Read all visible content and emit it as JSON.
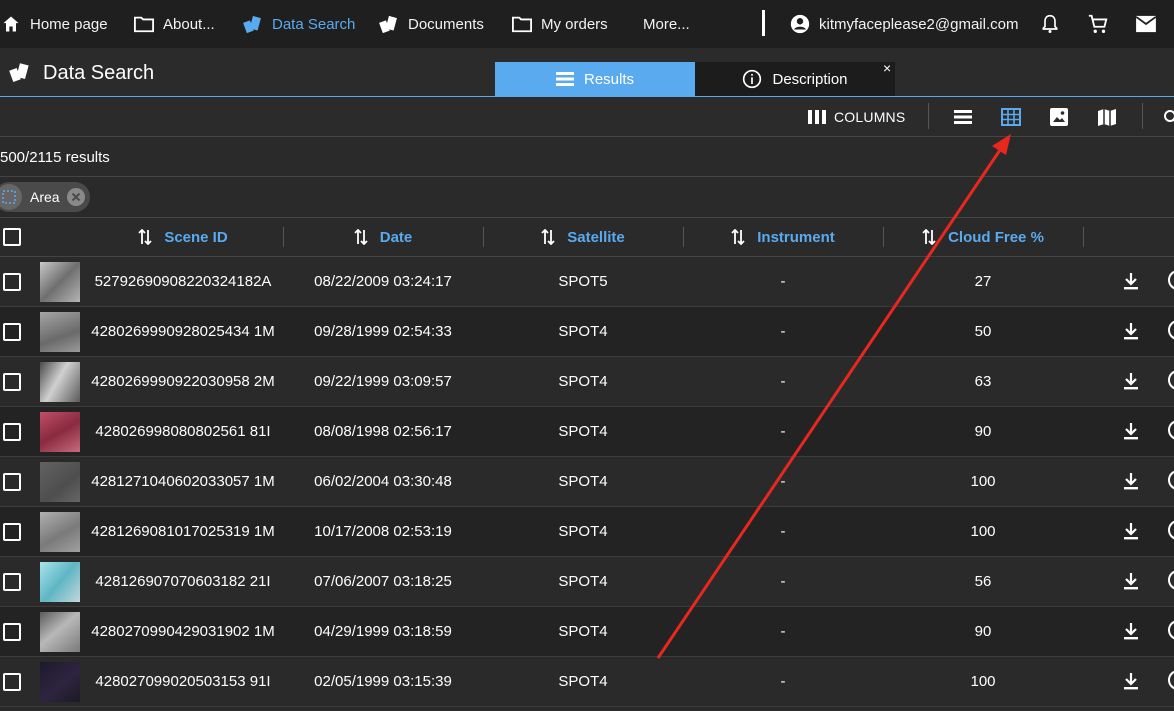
{
  "nav": {
    "home": "Home page",
    "about": "About...",
    "data_search": "Data Search",
    "documents": "Documents",
    "my_orders": "My orders",
    "more": "More...",
    "user_email": "kitmyfaceplease2@gmail.com"
  },
  "header": {
    "title": "Data Search",
    "tab_results": "Results",
    "tab_description": "Description",
    "tab_close": "×"
  },
  "toolbar": {
    "columns_label": "COLUMNS"
  },
  "results": {
    "count": "500/2115 results"
  },
  "filters": [
    {
      "label": "Area"
    }
  ],
  "table": {
    "columns": [
      "Scene ID",
      "Date",
      "Satellite",
      "Instrument",
      "Cloud Free %"
    ],
    "rows": [
      {
        "scene_id": "52792690908220324182A",
        "date": "08/22/2009 03:24:17",
        "satellite": "SPOT5",
        "instrument": "-",
        "cloud_free": "27",
        "thumb": "#9a9a9a"
      },
      {
        "scene_id": "4280269990928025434 1M",
        "date": "09/28/1999 02:54:33",
        "satellite": "SPOT4",
        "instrument": "-",
        "cloud_free": "50",
        "thumb": "#8c8c8c"
      },
      {
        "scene_id": "4280269990922030958 2M",
        "date": "09/22/1999 03:09:57",
        "satellite": "SPOT4",
        "instrument": "-",
        "cloud_free": "63",
        "thumb": "#7a7a7a"
      },
      {
        "scene_id": "428026998080802561 81I",
        "date": "08/08/1998 02:56:17",
        "satellite": "SPOT4",
        "instrument": "-",
        "cloud_free": "90",
        "thumb": "#b0405a"
      },
      {
        "scene_id": "4281271040602033057 1M",
        "date": "06/02/2004 03:30:48",
        "satellite": "SPOT4",
        "instrument": "-",
        "cloud_free": "100",
        "thumb": "#5e5e5e"
      },
      {
        "scene_id": "4281269081017025319 1M",
        "date": "10/17/2008 02:53:19",
        "satellite": "SPOT4",
        "instrument": "-",
        "cloud_free": "100",
        "thumb": "#8e8e8e"
      },
      {
        "scene_id": "428126907070603182 21I",
        "date": "07/06/2007 03:18:25",
        "satellite": "SPOT4",
        "instrument": "-",
        "cloud_free": "56",
        "thumb": "#8fd0dc"
      },
      {
        "scene_id": "4280270990429031902 1M",
        "date": "04/29/1999 03:18:59",
        "satellite": "SPOT4",
        "instrument": "-",
        "cloud_free": "90",
        "thumb": "#858585"
      },
      {
        "scene_id": "428027099020503153 91I",
        "date": "02/05/1999 03:15:39",
        "satellite": "SPOT4",
        "instrument": "-",
        "cloud_free": "100",
        "thumb": "#2a2238"
      }
    ]
  },
  "colors": {
    "accent": "#5aaaf0",
    "annotation_arrow": "#e8281e"
  }
}
